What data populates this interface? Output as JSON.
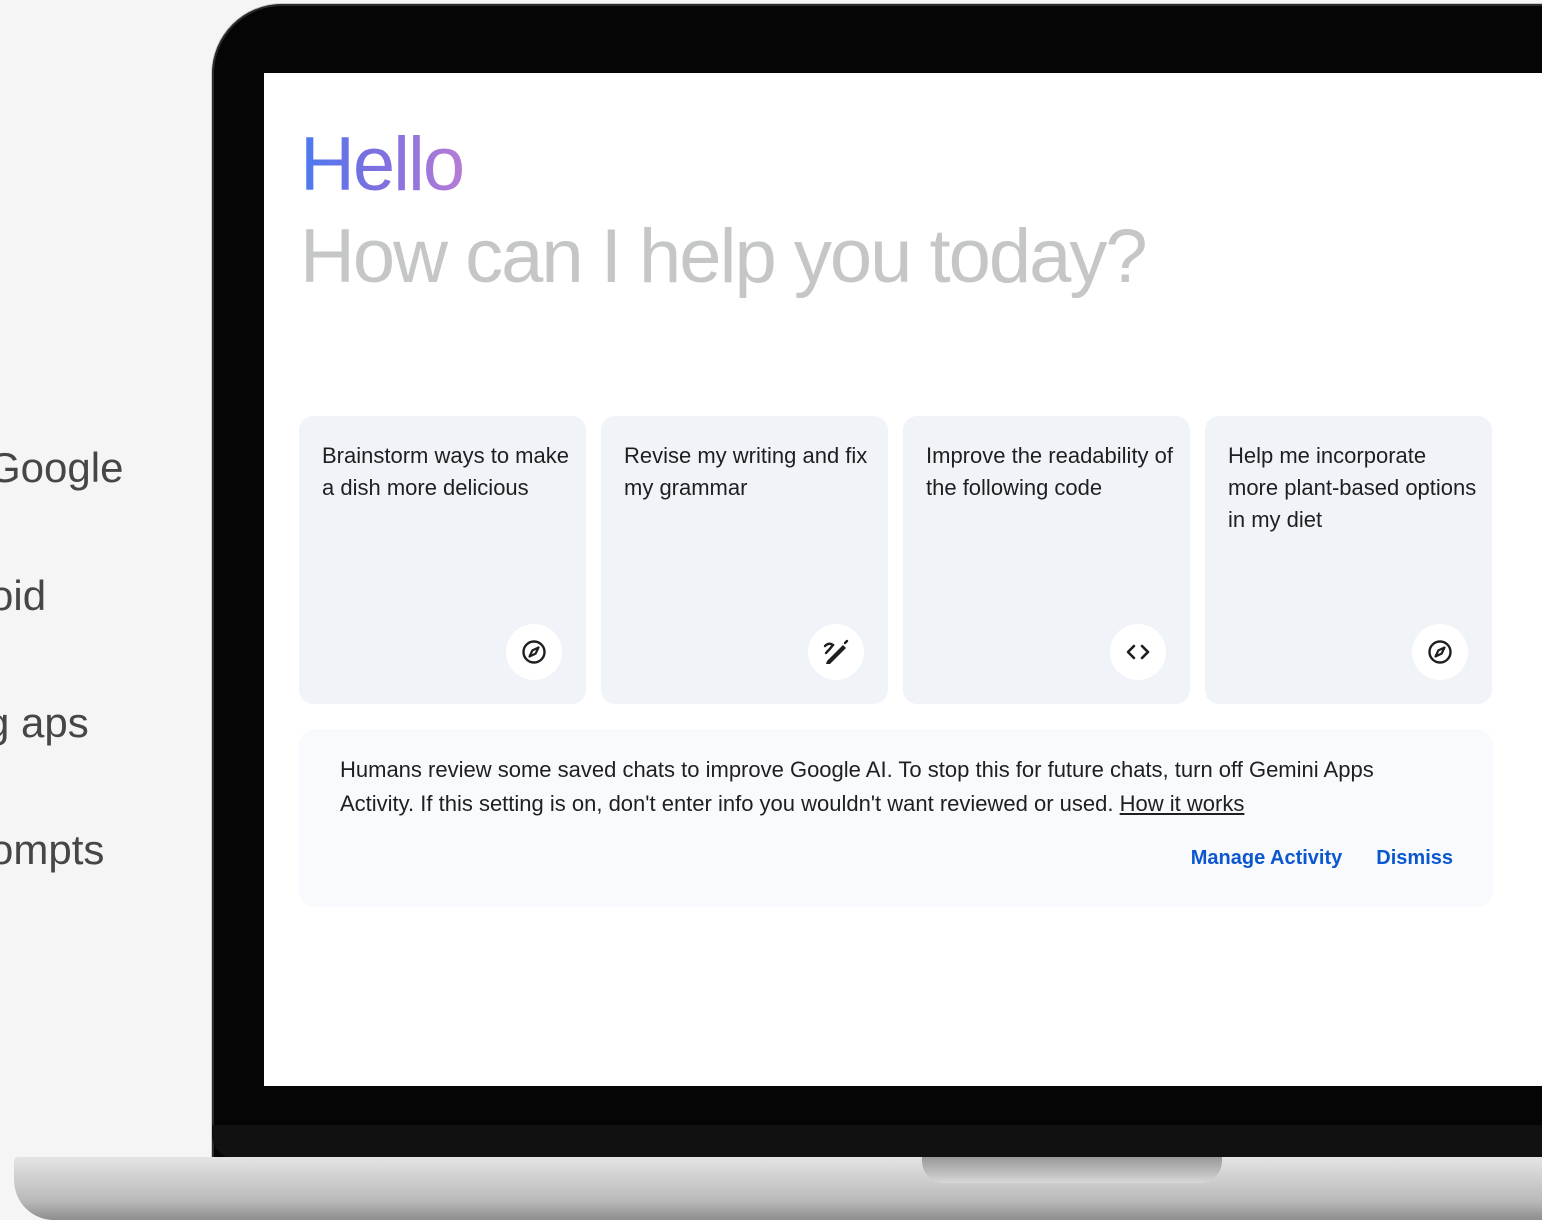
{
  "left_list": {
    "items": [
      "Google",
      "oid",
      "g aps",
      "ompts"
    ]
  },
  "greeting": {
    "hello": "Hello",
    "subtitle": "How can I help you today?"
  },
  "cards": [
    {
      "text": "Brainstorm ways to make a dish more delicious",
      "icon": "compass-icon"
    },
    {
      "text": "Revise my writing and fix my grammar",
      "icon": "edit-pen-icon"
    },
    {
      "text": "Improve the readability of the following code",
      "icon": "code-icon"
    },
    {
      "text": "Help me incorporate more plant-based options in my diet",
      "icon": "compass-icon"
    }
  ],
  "notice": {
    "text": "Humans review some saved chats to improve Google AI. To stop this for future chats, turn off Gemini Apps Activity. If this setting is on, don't enter info you wouldn't want reviewed or used.",
    "link": "How it works",
    "manage_label": "Manage Activity",
    "dismiss_label": "Dismiss"
  },
  "colors": {
    "page_bg": "#f5f5f5",
    "card_bg": "#f0f4f9",
    "link_blue": "#0b57d0",
    "subtitle_gray": "#c4c7c5",
    "hello_gradient_start": "#4a7af0",
    "hello_gradient_end": "#b67cd6"
  }
}
